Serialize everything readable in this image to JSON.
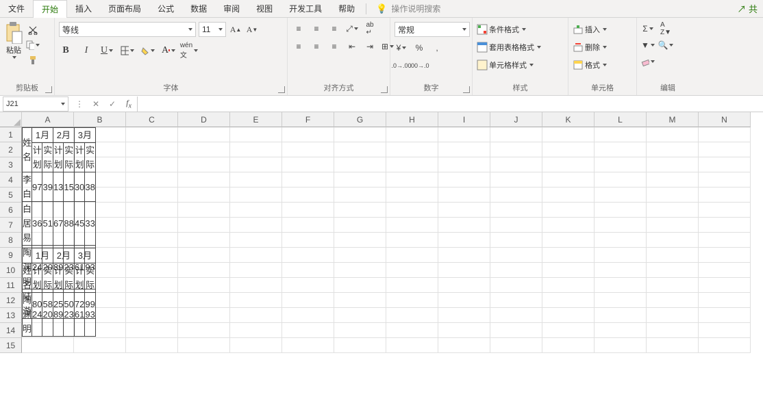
{
  "tabs": {
    "file": "文件",
    "home": "开始",
    "insert": "插入",
    "layout": "页面布局",
    "formula": "公式",
    "data": "数据",
    "review": "审阅",
    "view": "视图",
    "dev": "开发工具",
    "help": "帮助",
    "search_hint": "操作说明搜索",
    "share": "共"
  },
  "ribbon": {
    "clipboard": {
      "label": "剪贴板",
      "paste": "粘贴"
    },
    "font": {
      "label": "字体",
      "name": "等线",
      "size": "11"
    },
    "align": {
      "label": "对齐方式"
    },
    "number": {
      "label": "数字",
      "format": "常规"
    },
    "styles": {
      "label": "样式",
      "cond": "条件格式",
      "tbl": "套用表格格式",
      "cell": "单元格样式"
    },
    "cells": {
      "label": "单元格",
      "insert": "插入",
      "delete": "删除",
      "format": "格式"
    },
    "editing": {
      "label": "编辑"
    }
  },
  "namebox": "J21",
  "columns": [
    "A",
    "B",
    "C",
    "D",
    "E",
    "F",
    "G",
    "H",
    "I",
    "J",
    "K",
    "L",
    "M",
    "N"
  ],
  "rows": [
    "1",
    "2",
    "3",
    "4",
    "5",
    "6",
    "7",
    "8",
    "9",
    "10",
    "11",
    "12",
    "13",
    "14",
    "15"
  ],
  "table1": {
    "name": "姓名",
    "months": [
      "1月",
      "2月",
      "3月"
    ],
    "sub": {
      "plan": "计划",
      "actual": "实际"
    },
    "data": [
      {
        "name": "李白",
        "vals": [
          97,
          39,
          13,
          15,
          30,
          38
        ]
      },
      {
        "name": "白居易",
        "vals": [
          36,
          51,
          67,
          88,
          45,
          33
        ]
      },
      {
        "name": "陶渊明",
        "vals": [
          24,
          20,
          89,
          23,
          61,
          93
        ]
      },
      {
        "name": "陆游",
        "vals": [
          80,
          58,
          25,
          50,
          72,
          99
        ]
      }
    ]
  },
  "table2": {
    "name_blank": "",
    "name": "姓名",
    "months": [
      "1月",
      "2月",
      "3月"
    ],
    "sub": {
      "plan": "计划",
      "actual": "实际"
    },
    "data": [
      {
        "name": "陶渊明",
        "vals": [
          24,
          20,
          89,
          23,
          61,
          93
        ]
      }
    ]
  }
}
